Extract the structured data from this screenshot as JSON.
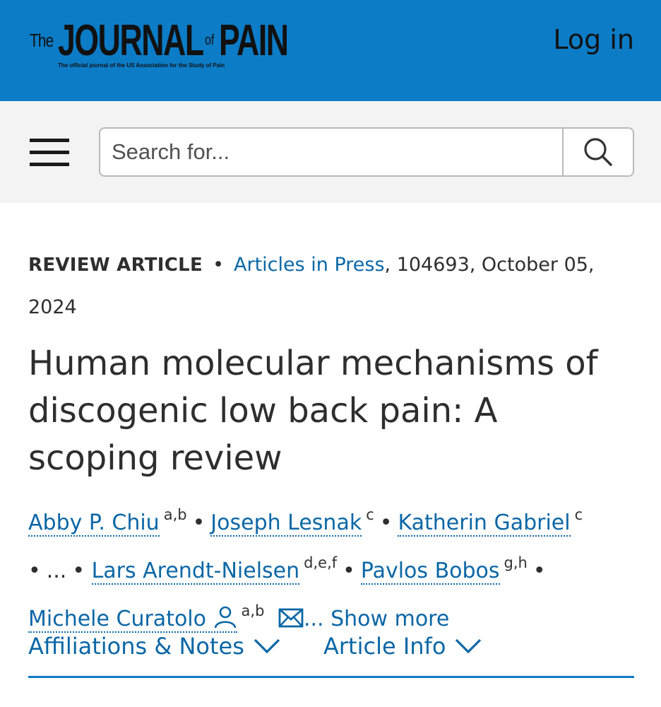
{
  "header": {
    "logo": {
      "the": "The",
      "journal": "JOURNAL",
      "of": "of",
      "pain": "PAIN",
      "tagline": "The official journal of the US Association for the Study of Pain"
    },
    "login_label": "Log in",
    "background_color": "#0c7cc7"
  },
  "search": {
    "placeholder": "Search for...",
    "menu_icon": "hamburger-menu-icon",
    "button_icon": "search-icon"
  },
  "article": {
    "type": "REVIEW ARTICLE",
    "separator": "•",
    "issue_link": "Articles in Press",
    "citation": ", 104693, October 05, 2024",
    "title": "Human molecular mechanisms of discogenic low back pain: A scoping review",
    "authors": [
      {
        "name": "Abby P. Chiu",
        "affiliation": "a,b"
      },
      {
        "name": "Joseph Lesnak",
        "affiliation": "c"
      },
      {
        "name": "Katherin Gabriel",
        "affiliation": "c"
      },
      {
        "name": "Lars Arendt-Nielsen",
        "affiliation": "d,e,f"
      },
      {
        "name": "Pavlos Bobos",
        "affiliation": "g,h"
      },
      {
        "name": "Michele Curatolo",
        "affiliation": "a,b"
      }
    ],
    "ellipsis": "...",
    "show_more": "... Show more"
  },
  "tabs": [
    {
      "label": "Affiliations & Notes",
      "icon": "chevron-down-icon"
    },
    {
      "label": "Article Info",
      "icon": "chevron-down-icon"
    }
  ],
  "colors": {
    "link": "#0b67a6",
    "accent": "#0c7cc7",
    "text": "#2e2e2e"
  }
}
